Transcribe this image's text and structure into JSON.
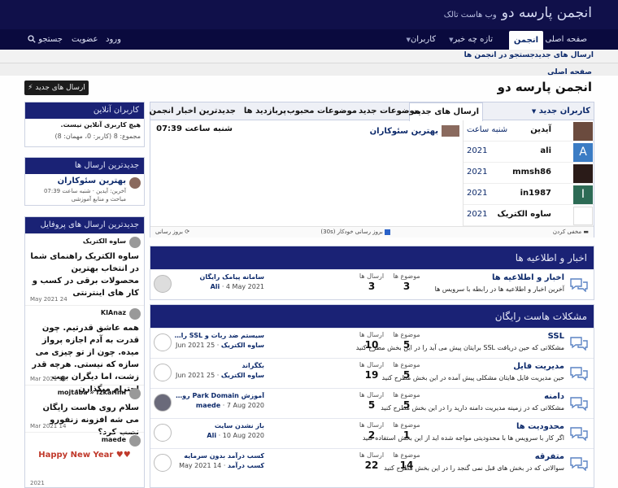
{
  "header": {
    "site_title": "انجمن پارسه دو",
    "tagline": "وب هاست تالک"
  },
  "nav": {
    "home": "صفحه اصلی",
    "forum": "انجمن",
    "whats_new": "تازه چه خبر",
    "members": "کاربران",
    "login": "ورود",
    "register": "عضویت",
    "search": "جستجو"
  },
  "subnav": {
    "new_posts": "ارسال های جدید",
    "search_forums": "جستجو در انجمن ها"
  },
  "breadcrumb": "صفحه اصلی",
  "page_title": "انجمن پارسه دو",
  "new_posts_button": "ارسال های جدید",
  "widget": {
    "tabs": [
      "کاربران جدید",
      "ارسال های جدید",
      "موضوعات جدید",
      "موضوعات محبوب",
      "پربازدید ها",
      "جدیدترین اخبار انجمن"
    ],
    "users": [
      {
        "name": "آیدین",
        "date": "شنبه ساعت"
      },
      {
        "name": "ali",
        "date": "2021"
      },
      {
        "name": "mmsh86",
        "date": "2021"
      },
      {
        "name": "in1987",
        "date": "2021"
      },
      {
        "name": "ساوه الکتریک",
        "date": "2021"
      }
    ],
    "feed_title": "بهترین سئوکاران",
    "feed_time": "شنبه ساعت 07:39",
    "footer": {
      "collapse": "مخفی کردن",
      "auto_refresh": "بروز رسانی خودکار (30s)",
      "refresh": "بروز رسانی"
    }
  },
  "news_block": {
    "title": "اخبار و اطلاعیه ها",
    "nodes": [
      {
        "title": "اخبار و اطلاعیه ها",
        "desc": "آخرین اخبار و اطلاعیه ها در رابطه با سرویس ها",
        "threads_label": "موضوع ها",
        "threads": "3",
        "posts_label": "ارسال ها",
        "posts": "3",
        "last_title": "سامانه پیامک رایگان",
        "last_date": "4 May 2021",
        "last_user": "Ali"
      }
    ]
  },
  "issues_block": {
    "title": "مشکلات هاست رایگان",
    "nodes": [
      {
        "title": "SSL",
        "desc": "مشکلاتی که حین دریافت SSL برایتان پیش می آید را در این بخش مطرح کنید",
        "threads": "5",
        "posts": "10",
        "last_title": "سیستم ضد ربات و SSL رایگان",
        "last_date": "25 Jun 2021",
        "last_user": "ساوه الکتریک"
      },
      {
        "title": "مدیریت فایل",
        "desc": "حین مدیریت فایل هایتان مشکلی پیش آمده در این بخش مطرح کنید",
        "threads": "5",
        "posts": "19",
        "last_title": "بکگراند",
        "last_date": "25 Jun 2021",
        "last_user": "ساوه الکتریک"
      },
      {
        "title": "دامنه",
        "desc": "مشکلاتی که در زمینه مدیریت دامنه دارید را در این بخش مطرح کنید",
        "threads": "5",
        "posts": "5",
        "last_title": "آموزش Park Domain روی هاست رایگ...",
        "last_date": "7 Aug 2020",
        "last_user": "maede"
      },
      {
        "title": "محدودیت ها",
        "desc": "اگر کار با سرویس ها با محدودیتی مواجه شده اید از این بخش استفاده کنید",
        "threads": "1",
        "posts": "2",
        "last_title": "باز نشدن سایت",
        "last_date": "10 Aug 2020",
        "last_user": "Ali"
      },
      {
        "title": "متفرقه",
        "desc": "سوالاتی که در بخش های قبل نمی گنجد را در این بخش مطرح کنید",
        "threads": "14",
        "posts": "22",
        "last_title": "کسب درآمد بدون سرمایه",
        "last_date": "14 May 2021",
        "last_user": "کسب درآمد"
      }
    ]
  },
  "sidebar": {
    "online": {
      "title": "کاربران آنلاین",
      "empty": "هیچ کاربری آنلاین نیست.",
      "total": "مجموع: 8 (کاربر: 0، مهمان: 8)"
    },
    "latest": {
      "title": "جدیدترین ارسال ها",
      "post_title": "بهترین سئوکاران",
      "meta": "آخرین: آیدین · شنبه ساعت 07:39",
      "forum": "مباحث و منابع آموزشی"
    },
    "profile": {
      "title": "جدیدترین ارسال های پروفایل",
      "posts": [
        {
          "user": "ساوه الکتریک",
          "text": "ساوه الکتریک راهنمای شما در انتخاب بهترین محصولات برقی در کسب و کار های اینترنتی",
          "date": "24 May 2021"
        },
        {
          "user": "KIAnaz",
          "text": "همه عاشق قدرتیم. چون قدرت به آدم اجازه پرواز میده. چون از تو چیزی می سازه که نیستی. هرچه قدر زشت، اما دیگران بهت احترام میگذارن.",
          "date": "19 Mar 2021"
        },
        {
          "user": "mojtaba » fzkarimi",
          "text": "سلام روی هاست رایگان می شه افزونه زنفورو نصب کرد؟",
          "date": "14 Mar 2021"
        },
        {
          "user": "maede",
          "text": "♥♥ Happy New Year",
          "date": "2021"
        }
      ]
    }
  },
  "colors": {
    "header": "#10104a",
    "nav": "#0a0a3e",
    "block_head": "#1a2275",
    "link": "#0d2a6b"
  }
}
